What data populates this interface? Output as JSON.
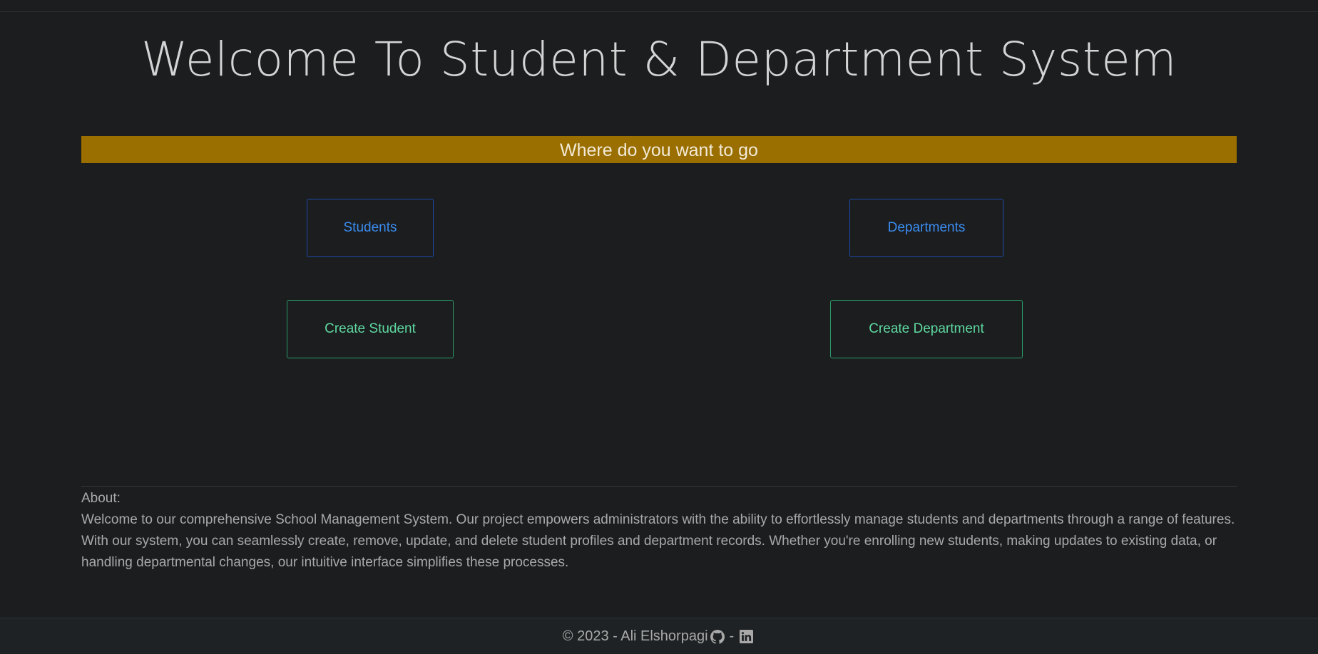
{
  "header": {
    "title": "Welcome To Student & Department System"
  },
  "banner": {
    "text": "Where do you want to go"
  },
  "nav": {
    "students_label": "Students",
    "departments_label": "Departments",
    "create_student_label": "Create Student",
    "create_department_label": "Create Department"
  },
  "about": {
    "heading": "About:",
    "text": "Welcome to our comprehensive School Management System. Our project empowers administrators with the ability to effortlessly manage students and departments through a range of features. With our system, you can seamlessly create, remove, update, and delete student profiles and department records. Whether you're enrolling new students, making updates to existing data, or handling departmental changes, our intuitive interface simplifies these processes."
  },
  "footer": {
    "copyright": "© 2023 - Ali Elshorpagi",
    "separator": "-",
    "icons": [
      "github-icon",
      "linkedin-icon"
    ]
  },
  "colors": {
    "background": "#1b1d1f",
    "banner": "#9a6f00",
    "primary_outline": "#3b8cf0",
    "success_outline": "#5fd9a0"
  }
}
